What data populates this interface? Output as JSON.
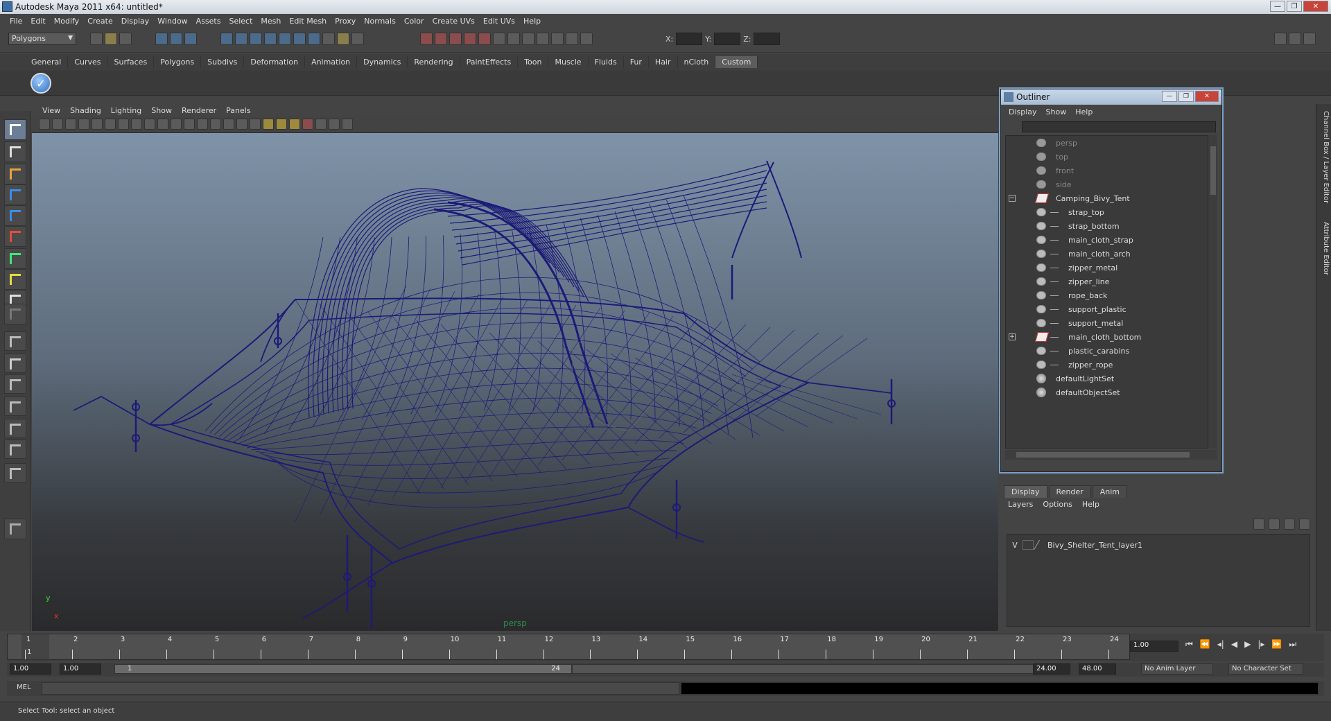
{
  "window": {
    "title": "Autodesk Maya 2011 x64: untitled*"
  },
  "menubar": [
    "File",
    "Edit",
    "Modify",
    "Create",
    "Display",
    "Window",
    "Assets",
    "Select",
    "Mesh",
    "Edit Mesh",
    "Proxy",
    "Normals",
    "Color",
    "Create UVs",
    "Edit UVs",
    "Help"
  ],
  "statusline": {
    "mode": "Polygons",
    "x_label": "X:",
    "y_label": "Y:",
    "z_label": "Z:"
  },
  "shelf": {
    "tabs": [
      "General",
      "Curves",
      "Surfaces",
      "Polygons",
      "Subdivs",
      "Deformation",
      "Animation",
      "Dynamics",
      "Rendering",
      "PaintEffects",
      "Toon",
      "Muscle",
      "Fluids",
      "Fur",
      "Hair",
      "nCloth",
      "Custom"
    ],
    "active_tab": "Custom"
  },
  "viewport": {
    "menu": [
      "View",
      "Shading",
      "Lighting",
      "Show",
      "Renderer",
      "Panels"
    ],
    "camera_label": "persp",
    "axis_x": "x",
    "axis_y": "y",
    "wire_color": "#1c1a78"
  },
  "outliner": {
    "title": "Outliner",
    "menu": [
      "Display",
      "Show",
      "Help"
    ],
    "rows": [
      {
        "label": "persp",
        "kind": "camera",
        "dim": true,
        "indent": 0
      },
      {
        "label": "top",
        "kind": "camera",
        "dim": true,
        "indent": 0
      },
      {
        "label": "front",
        "kind": "camera",
        "dim": true,
        "indent": 0
      },
      {
        "label": "side",
        "kind": "camera",
        "dim": true,
        "indent": 0
      },
      {
        "label": "Camping_Bivy_Tent",
        "kind": "group",
        "expander": "−",
        "indent": 0
      },
      {
        "label": "strap_top",
        "kind": "mesh",
        "indent": 1
      },
      {
        "label": "strap_bottom",
        "kind": "mesh",
        "indent": 1
      },
      {
        "label": "main_cloth_strap",
        "kind": "mesh",
        "indent": 1
      },
      {
        "label": "main_cloth_arch",
        "kind": "mesh",
        "indent": 1
      },
      {
        "label": "zipper_metal",
        "kind": "mesh",
        "indent": 1
      },
      {
        "label": "zipper_line",
        "kind": "mesh",
        "indent": 1
      },
      {
        "label": "rope_back",
        "kind": "mesh",
        "indent": 1
      },
      {
        "label": "support_plastic",
        "kind": "mesh",
        "indent": 1
      },
      {
        "label": "support_metal",
        "kind": "mesh",
        "indent": 1
      },
      {
        "label": "main_cloth_bottom",
        "kind": "group",
        "expander": "+",
        "indent": 1
      },
      {
        "label": "plastic_carabins",
        "kind": "mesh",
        "indent": 1
      },
      {
        "label": "zipper_rope",
        "kind": "mesh",
        "indent": 1
      },
      {
        "label": "defaultLightSet",
        "kind": "set",
        "indent": 0
      },
      {
        "label": "defaultObjectSet",
        "kind": "set",
        "indent": 0
      }
    ]
  },
  "sidebar": {
    "tab1": "Channel Box / Layer Editor",
    "tab2": "Attribute Editor"
  },
  "layers": {
    "tabs": [
      "Display",
      "Render",
      "Anim"
    ],
    "active_tab": "Display",
    "menu": [
      "Layers",
      "Options",
      "Help"
    ],
    "rows": [
      {
        "visible": "V",
        "name": "Bivy_Shelter_Tent_layer1"
      }
    ]
  },
  "timeline": {
    "ticks": [
      1,
      2,
      3,
      4,
      5,
      6,
      7,
      8,
      9,
      10,
      11,
      12,
      13,
      14,
      15,
      16,
      17,
      18,
      19,
      20,
      21,
      22,
      23,
      24
    ],
    "current_frame": "1",
    "current_time_field": "1.00"
  },
  "range": {
    "start_time": "1.00",
    "playback_start": "1.00",
    "slider_start": "1",
    "slider_end": "24",
    "playback_end": "24.00",
    "end_time": "48.00",
    "anim_layer": "No Anim Layer",
    "character_set": "No Character Set"
  },
  "command": {
    "label": "MEL"
  },
  "help": {
    "text": "Select Tool: select an object"
  }
}
